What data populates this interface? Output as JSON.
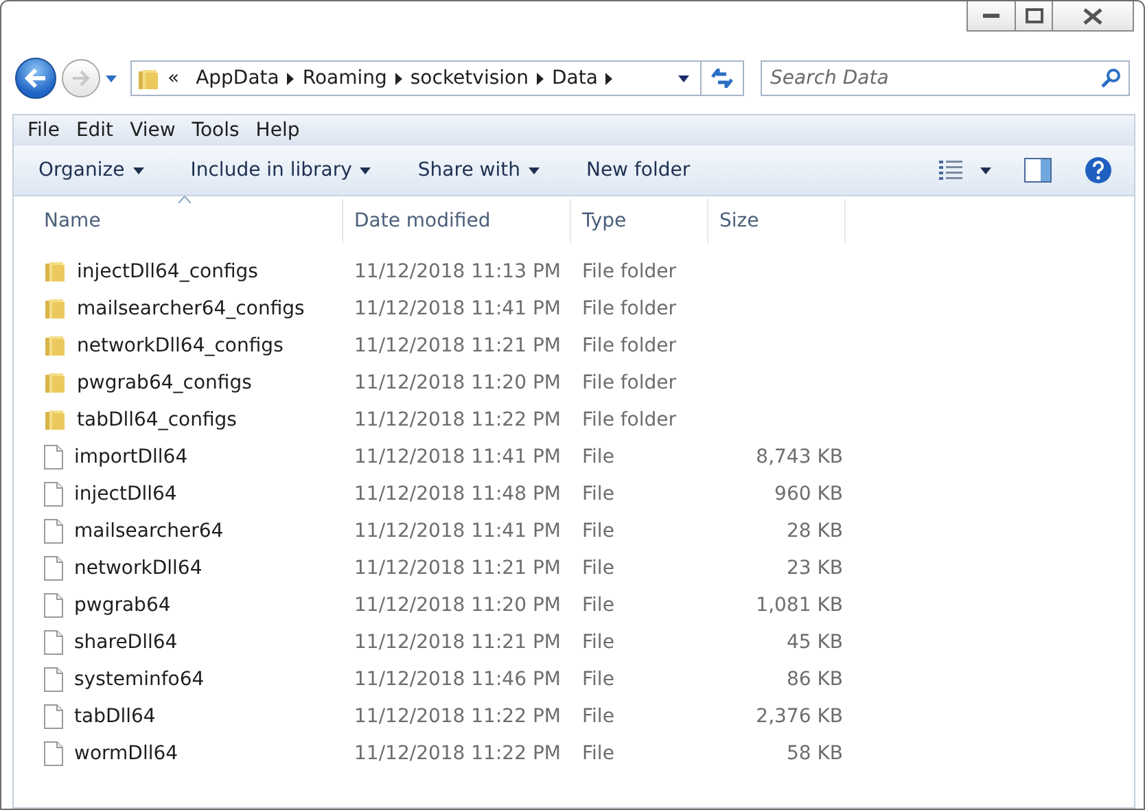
{
  "breadcrumb": [
    "«",
    "AppData",
    "Roaming",
    "socketvision",
    "Data"
  ],
  "search": {
    "placeholder": "Search Data"
  },
  "menu": [
    "File",
    "Edit",
    "View",
    "Tools",
    "Help"
  ],
  "commands": [
    {
      "label": "Organize",
      "dropdown": true
    },
    {
      "label": "Include in library",
      "dropdown": true
    },
    {
      "label": "Share with",
      "dropdown": true
    },
    {
      "label": "New folder",
      "dropdown": false
    }
  ],
  "columns": [
    {
      "label": "Name",
      "sorted": true
    },
    {
      "label": "Date modified",
      "sorted": false
    },
    {
      "label": "Type",
      "sorted": false
    },
    {
      "label": "Size",
      "sorted": false
    }
  ],
  "rows": [
    {
      "kind": "folder",
      "name": "injectDll64_configs",
      "date": "11/12/2018 11:13 PM",
      "type": "File folder"
    },
    {
      "kind": "folder",
      "name": "mailsearcher64_configs",
      "date": "11/12/2018 11:41 PM",
      "type": "File folder"
    },
    {
      "kind": "folder",
      "name": "networkDll64_configs",
      "date": "11/12/2018 11:21 PM",
      "type": "File folder"
    },
    {
      "kind": "folder",
      "name": "pwgrab64_configs",
      "date": "11/12/2018 11:20 PM",
      "type": "File folder"
    },
    {
      "kind": "folder",
      "name": "tabDll64_configs",
      "date": "11/12/2018 11:22 PM",
      "type": "File folder"
    },
    {
      "kind": "file",
      "name": "importDll64",
      "date": "11/12/2018 11:41 PM",
      "type": "File",
      "size": "8,743 KB"
    },
    {
      "kind": "file",
      "name": "injectDll64",
      "date": "11/12/2018 11:48 PM",
      "type": "File",
      "size": "960 KB"
    },
    {
      "kind": "file",
      "name": "mailsearcher64",
      "date": "11/12/2018 11:41 PM",
      "type": "File",
      "size": "28 KB"
    },
    {
      "kind": "file",
      "name": "networkDll64",
      "date": "11/12/2018 11:21 PM",
      "type": "File",
      "size": "23 KB"
    },
    {
      "kind": "file",
      "name": "pwgrab64",
      "date": "11/12/2018 11:20 PM",
      "type": "File",
      "size": "1,081 KB"
    },
    {
      "kind": "file",
      "name": "shareDll64",
      "date": "11/12/2018 11:21 PM",
      "type": "File",
      "size": "45 KB"
    },
    {
      "kind": "file",
      "name": "systeminfo64",
      "date": "11/12/2018 11:46 PM",
      "type": "File",
      "size": "86 KB"
    },
    {
      "kind": "file",
      "name": "tabDll64",
      "date": "11/12/2018 11:22 PM",
      "type": "File",
      "size": "2,376 KB"
    },
    {
      "kind": "file",
      "name": "wormDll64",
      "date": "11/12/2018 11:22 PM",
      "type": "File",
      "size": "58 KB"
    }
  ]
}
